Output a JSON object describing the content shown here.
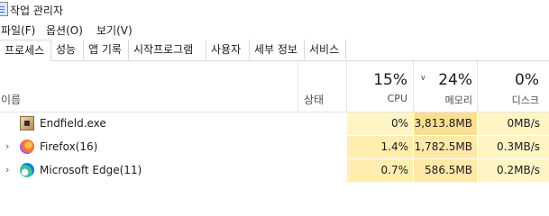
{
  "window": {
    "title": "작업 관리자"
  },
  "menu": [
    "파일(F)",
    "옵션(O)",
    "보기(V)"
  ],
  "tabs": [
    "프로세스",
    "성능",
    "앱 기록",
    "시작프로그램",
    "사용자",
    "세부 정보",
    "서비스"
  ],
  "columns": {
    "name": "이름",
    "status": "상태",
    "cpu": {
      "percent": "15%",
      "label": "CPU"
    },
    "memory": {
      "percent": "24%",
      "label": "메모리"
    },
    "disk": {
      "percent": "0%",
      "label": "디스크"
    }
  },
  "processes": [
    {
      "name": "Endfield.exe",
      "icon": "endfield-app-icon",
      "cpu": "0%",
      "memory": "3,813.8MB",
      "disk": "0MB/s",
      "expandable": false
    },
    {
      "name": "Firefox(16)",
      "icon": "firefox-icon",
      "cpu": "1.4%",
      "memory": "1,782.5MB",
      "disk": "0.3MB/s",
      "expandable": true
    },
    {
      "name": "Microsoft Edge(11)",
      "icon": "edge-icon",
      "cpu": "0.7%",
      "memory": "586.5MB",
      "disk": "0.2MB/s",
      "expandable": true
    }
  ],
  "colors": {
    "heat_low": "#fff4c4",
    "heat_mid": "#ffe9a8",
    "heat_high": "#f9df93"
  }
}
